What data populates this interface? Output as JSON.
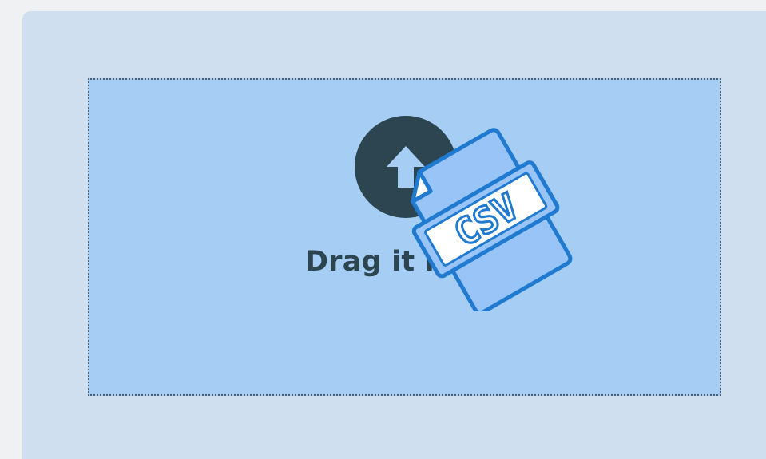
{
  "dropzone": {
    "prompt": "Drag it here",
    "upload_icon": "upload-arrow-icon",
    "file_icon": "csv-file-icon",
    "file_icon_label": "CSV"
  },
  "colors": {
    "panel_bg": "#d0dfef",
    "dropzone_bg": "#a6cdf4",
    "dropzone_border": "#4f5f72",
    "text": "#2d4550",
    "file_fill": "#98c4f8",
    "file_stroke": "#1f7ad0"
  }
}
